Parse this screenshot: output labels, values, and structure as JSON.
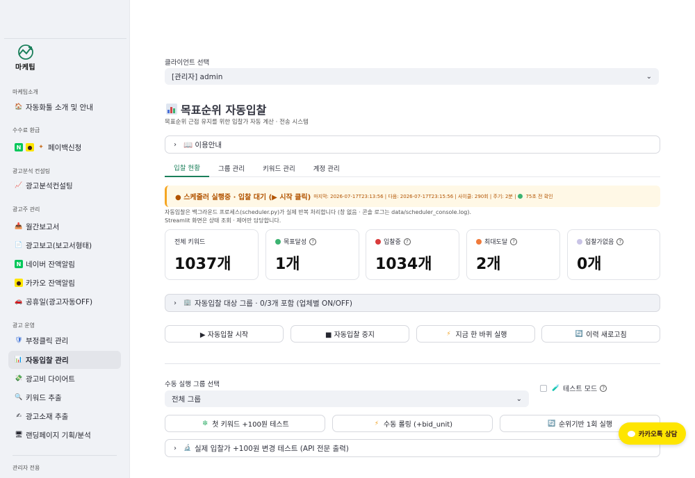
{
  "sidebar": {
    "logo_text": "마케팁",
    "sections": [
      {
        "label": "마케팁소개"
      },
      {
        "label": "수수료 환급"
      },
      {
        "label": "광고분석 컨설팅"
      },
      {
        "label": "광고주 관리"
      },
      {
        "label": "광고 운영"
      },
      {
        "label": "관리자 전용"
      }
    ],
    "items": [
      {
        "label": "자동화툴 소개 및 안내",
        "icon": "house-icon"
      },
      {
        "label": "페이백신청",
        "icon": "payback-icon"
      },
      {
        "label": "광고분석컨설팅",
        "icon": "chart-up-icon"
      },
      {
        "label": "월간보고서",
        "icon": "inbox-icon"
      },
      {
        "label": "광고보고(보고서형태)",
        "icon": "document-icon"
      },
      {
        "label": "네이버 잔액알림",
        "icon": "naver-icon"
      },
      {
        "label": "카카오 잔액알림",
        "icon": "kakao-icon"
      },
      {
        "label": "공휴일(광고자동OFF)",
        "icon": "car-icon"
      },
      {
        "label": "부정클릭 관리",
        "icon": "shield-icon"
      },
      {
        "label": "자동입찰 관리",
        "icon": "bar-chart-icon"
      },
      {
        "label": "광고비 다이어트",
        "icon": "money-icon"
      },
      {
        "label": "키워드 추출",
        "icon": "magnifier-icon"
      },
      {
        "label": "광고소재 추출",
        "icon": "pen-icon"
      },
      {
        "label": "랜딩페이지 기획/분석",
        "icon": "monitor-icon"
      }
    ]
  },
  "client_select": {
    "label": "클라이언트 선택",
    "value": "[관리자] admin"
  },
  "page": {
    "title": "목표순위 자동입찰",
    "subtitle": "목표순위 근접 유지를 위한 입찰가 자동 계산 · 전송 시스템",
    "guide_expander": "📖 이용안내"
  },
  "tabs": [
    "입찰 현황",
    "그룹 관리",
    "키워드 관리",
    "계정 관리"
  ],
  "active_tab": 0,
  "status": {
    "main": "● 스케줄러 실행중 · 입찰 대기 (▶ 시작 클릭)",
    "meta": "마지막: 2026-07-17T23:13:56 | 다음: 2026-07-17T23:15:56 | 사이클: 290회 | 주기: 2분 |",
    "meta_tail": "75초 전 확인",
    "note_line1": "자동입찰은 백그라운드 프로세스(scheduler.py)가 실제 반복 처리합니다 (창 없음 · 콘솔 로그는 data/scheduler_console.log).",
    "note_line2": "Streamlit 화면은 상태 조회 · 제어만 담당합니다."
  },
  "metrics": [
    {
      "label": "전체 키워드",
      "value": "1037개",
      "dot": ""
    },
    {
      "label": "목표달성",
      "value": "1개",
      "dot": "#3cb371"
    },
    {
      "label": "입찰중",
      "value": "1034개",
      "dot": "#d93b3b"
    },
    {
      "label": "최대도달",
      "value": "2개",
      "dot": "#f07a3a"
    },
    {
      "label": "입찰가없음",
      "value": "0개",
      "dot": "#c9c4e6"
    }
  ],
  "group_expander": "자동입찰 대상 그룹 · 0/3개 포함 (업체별 ON/OFF)",
  "controls": {
    "start": "▶ 자동입찰 시작",
    "stop": "■ 자동입찰 중지",
    "run_once": "지금 한 바퀴 실행",
    "refresh": "이력 새로고침"
  },
  "manual": {
    "label": "수동 실행 그룹 선택",
    "value": "전체 그룹",
    "test_mode": "테스트 모드",
    "btn_first": "첫 키워드 +100원 테스트",
    "btn_rolling": "수동 롤링 (+bid_unit)",
    "btn_rank": "순위기반 1회 실행",
    "api_expander": "실제 입찰가 +100원 변경 테스트 (API 전문 출력)"
  },
  "kakao_consult": "카카오톡 상담",
  "colors": {
    "accent": "#1a7f5a",
    "warning_bg": "#fff8e6",
    "warning_text": "#b25300",
    "kakao_yellow": "#fee500",
    "naver_green": "#03c75a"
  }
}
